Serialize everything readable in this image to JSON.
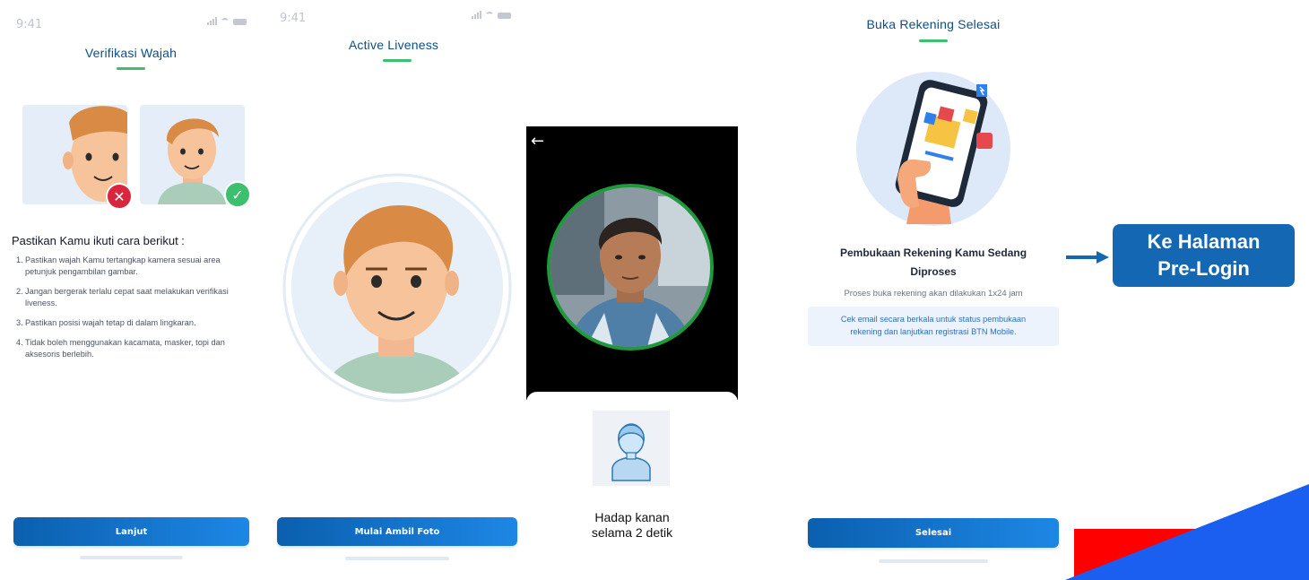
{
  "screen1": {
    "status_time": "9:41",
    "title": "Verifikasi Wajah",
    "wrong_badge": "✕",
    "right_badge": "✓",
    "instructions_heading": "Pastikan Kamu ikuti cara berikut :",
    "instructions": [
      {
        "num": "1.",
        "text": "Pastikan wajah Kamu tertangkap kamera sesuai area petunjuk pengambilan gambar."
      },
      {
        "num": "2.",
        "text": "Jangan bergerak terlalu cepat saat melakukan verifikasi liveness."
      },
      {
        "num": "3.",
        "text": "Pastikan posisi wajah tetap di dalam lingkaran."
      },
      {
        "num": "4.",
        "text": "Tidak boleh menggunakan kacamata, masker, topi dan aksesoris berlebih."
      }
    ],
    "button_label": "Lanjut"
  },
  "screen2": {
    "status_time": "9:41",
    "title": "Active Liveness",
    "button_label": "Mulai Ambil Foto"
  },
  "screen3": {
    "back_icon": "←",
    "pose_text_line1": "Hadap kanan",
    "pose_text_line2": "selama 2 detik"
  },
  "screen4": {
    "title": "Buka Rekening Selesai",
    "heading_line1": "Pembukaan Rekening Kamu Sedang",
    "heading_line2": "Diproses",
    "subtitle": "Proses buka rekening akan dilakukan 1x24 jam",
    "note_line1": "Cek email secara berkala untuk status pembukaan",
    "note_line2": "rekening dan lanjutkan registrasi BTN Mobile.",
    "button_label": "Selesai"
  },
  "annotation": {
    "callout_line1": "Ke Halaman",
    "callout_line2": "Pre-Login"
  },
  "colors": {
    "primary": "#1367b3",
    "accent_green": "#3dbf6d",
    "error_red": "#d7263d",
    "deco_blue": "#1a5ff0",
    "deco_red": "#ff0000"
  }
}
